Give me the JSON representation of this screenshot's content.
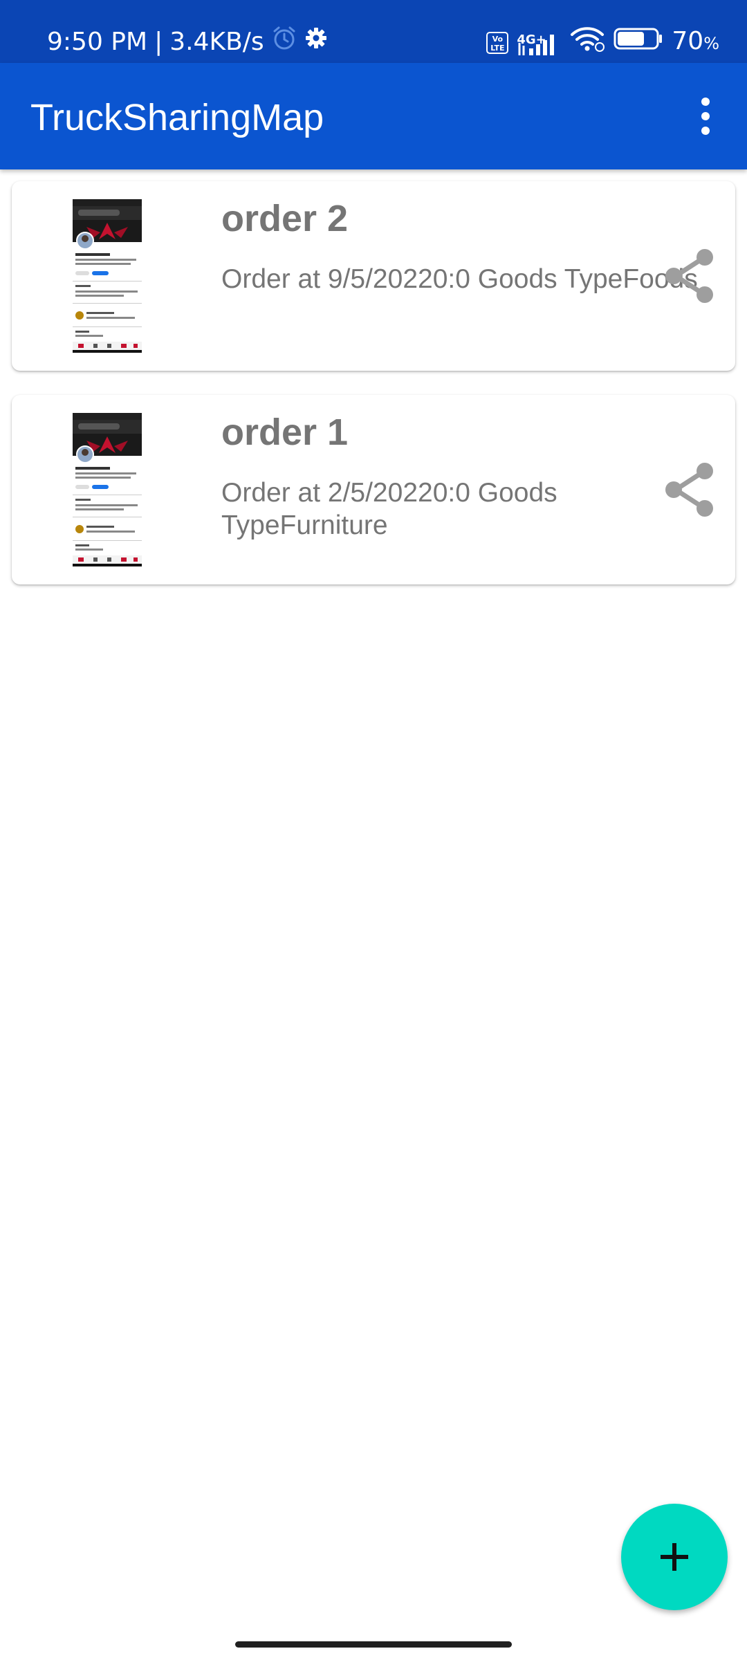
{
  "status_bar": {
    "time": "9:50 PM",
    "separator": "|",
    "speed": "3.4KB/s",
    "network": "4G+",
    "volte": "Vo LTE",
    "battery_percent": "70",
    "battery_unit": "%",
    "battery_level": 0.7,
    "icons": [
      "alarm-icon",
      "settings-gear-icon",
      "volte-icon",
      "signal-icon",
      "wifi-icon",
      "battery-icon"
    ]
  },
  "app_bar": {
    "title": "TruckSharingMap",
    "menu_icon": "more-vert-icon"
  },
  "orders": [
    {
      "title": "order 2",
      "description": "Order at 9/5/20220:0 Goods TypeFoods",
      "thumbnail_icon": "order-thumbnail-image",
      "share_icon": "share-icon"
    },
    {
      "title": "order 1",
      "description": "Order at 2/5/20220:0 Goods TypeFurniture",
      "thumbnail_icon": "order-thumbnail-image",
      "share_icon": "share-icon"
    }
  ],
  "fab": {
    "icon": "add-icon"
  },
  "colors": {
    "status_bar": "#0b45b4",
    "app_bar": "#0b55d0",
    "fab": "#00d9c1",
    "card_text": "#757575",
    "share_icon": "#9e9e9e"
  }
}
